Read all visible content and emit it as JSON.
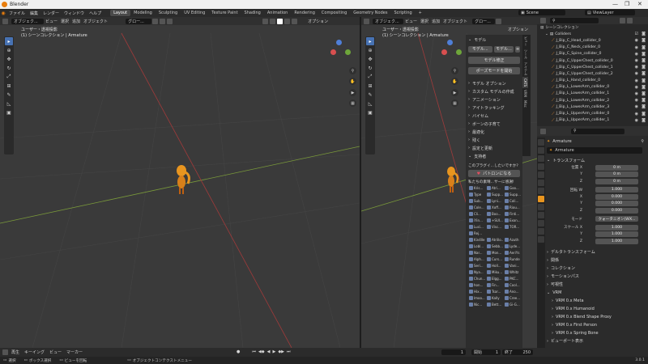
{
  "window": {
    "title": "Blender",
    "controls": [
      "—",
      "❐",
      "✕"
    ]
  },
  "topbar": {
    "menus": [
      "ファイル",
      "編集",
      "レンダー",
      "ウィンドウ",
      "ヘルプ"
    ],
    "workspaces": [
      "Layout",
      "Modeling",
      "Sculpting",
      "UV Editing",
      "Texture Paint",
      "Shading",
      "Animation",
      "Rendering",
      "Compositing",
      "Geometry Nodes",
      "Scripting"
    ],
    "active_workspace": "Layout",
    "add_tab": "+",
    "scene": "Scene",
    "view_layer": "ViewLayer"
  },
  "viewport_left": {
    "mode": "オブジェク...",
    "menus": [
      "ビュー",
      "選択",
      "追加",
      "オブジェクト"
    ],
    "transform": "グロー...",
    "options": "オプション",
    "info_line1": "ユーザー・透視投影",
    "info_line2": "(1) シーンコレクション | Armature"
  },
  "viewport_right": {
    "mode": "オブジェク...",
    "menus": [
      "ビュー",
      "選択",
      "追加",
      "オブジェクト"
    ],
    "transform": "グロー...",
    "options": "オプション",
    "info_line1": "ユーザー・透視投影",
    "info_line2": "(1) シーンコレクション | Armature"
  },
  "npanel": {
    "model_header": "モデル",
    "btn_model1": "モデル...",
    "btn_model2": "モデル...",
    "btn_model_fix": "モデル修正",
    "btn_pose_mode": "ポーズモードを開始",
    "sections": [
      "モデル オプション",
      "カスタム モデルの作成",
      "アニメーション",
      "アイトラッキング",
      "バイセム",
      "ボーンの子育て",
      "最適化",
      "残く",
      "設定と更新",
      "支持者"
    ],
    "patron_text": "このプラグイ...したいですか?",
    "patron_btn": "パトロンになる",
    "thanks_text": "私たちの素晴...サーに感謝!",
    "addons": [
      "Kris...",
      "Atri...",
      "Goo...",
      "Type",
      "Supp...",
      "Supp...",
      "Sub...",
      "Lyni...",
      "Coli...",
      "Cole...",
      "Xoff...",
      "Riou...",
      "Cli...",
      "Boo...",
      "Finti...",
      "iYin...",
      "+SUI...",
      "Exon...",
      "Luci...",
      "Visc...",
      "TOR...",
      "Rej...",
      "",
      "",
      "Kin4lle",
      "Atrillo...",
      "Azuth",
      "Lobl...",
      "Sebb...",
      "Lyde...",
      "Nar...",
      "Mon...",
      "AeriYs",
      "Alph...",
      "Curs...",
      "Runde",
      "Seri...",
      "HoIl...",
      "Vani...",
      "Nya...",
      "Miku...",
      "Whitz",
      "Chun...",
      "Elgg...",
      "PKC...",
      "hon...",
      "Fin...",
      "Cool...",
      "Hix...",
      "Tsar...",
      "Ano...",
      "lmoo...",
      "Kally",
      "Cree...",
      "Nic...",
      "Bett...",
      "Gi-G..."
    ],
    "tabs": [
      "ビュー",
      "ツール",
      "アイテム",
      "CATS",
      "VRM",
      "Misc"
    ]
  },
  "outliner": {
    "header_label": "シーンコレクション",
    "collection": "Colliders",
    "items": [
      "J_Bip_C_Head_collider_0",
      "J_Bip_C_Neck_collider_0",
      "J_Bip_C_Spine_collider_0",
      "J_Bip_C_UpperChest_collider_0",
      "J_Bip_C_UpperChest_collider_1",
      "J_Bip_C_UpperChest_collider_2",
      "J_Bip_L_Hand_collider_0",
      "J_Bip_L_LowerArm_collider_0",
      "J_Bip_L_LowerArm_collider_1",
      "J_Bip_L_LowerArm_collider_2",
      "J_Bip_L_LowerArm_collider_3",
      "J_Bip_L_UpperArm_collider_0",
      "J_Bip_L_UpperArm_collider_1"
    ]
  },
  "properties": {
    "object_name": "Armature",
    "data_name": "Armature",
    "transform_header": "トランスフォーム",
    "fields": [
      {
        "label": "位置 X",
        "value": "0 m"
      },
      {
        "label": "Y",
        "value": "0 m"
      },
      {
        "label": "Z",
        "value": "0 m"
      },
      {
        "label": "回転 W",
        "value": "1.000"
      },
      {
        "label": "X",
        "value": "0.000"
      },
      {
        "label": "Y",
        "value": "0.000"
      },
      {
        "label": "Z",
        "value": "0.000"
      },
      {
        "label": "モード",
        "value": "クォータニオン(WX..."
      },
      {
        "label": "スケール X",
        "value": "1.000"
      },
      {
        "label": "Y",
        "value": "1.000"
      },
      {
        "label": "Z",
        "value": "1.000"
      }
    ],
    "sections": [
      "デルタトランスフォーム",
      "関係",
      "コレクション",
      "モーションパス",
      "可視性",
      "VRM"
    ],
    "vrm_items": [
      "VRM 0.x Meta",
      "VRM 0.x Humanoid",
      "VRM 0.x Blend Shape Proxy",
      "VRM 0.x First Person",
      "VRM 0.x Spring Bone"
    ],
    "viewport_display": "ビューポート表示"
  },
  "timeline": {
    "menus": [
      "再生",
      "キーイング",
      "ビュー",
      "マーカー"
    ],
    "current_frame": "1",
    "start_label": "開始",
    "start": "1",
    "end_label": "終了",
    "end": "250"
  },
  "statusbar": {
    "select": "選択",
    "box_select": "ボックス選択",
    "rotate_view": "ビューを回転",
    "context_menu": "オブジェクトコンテクストメニュー",
    "version": "3.0.1"
  }
}
